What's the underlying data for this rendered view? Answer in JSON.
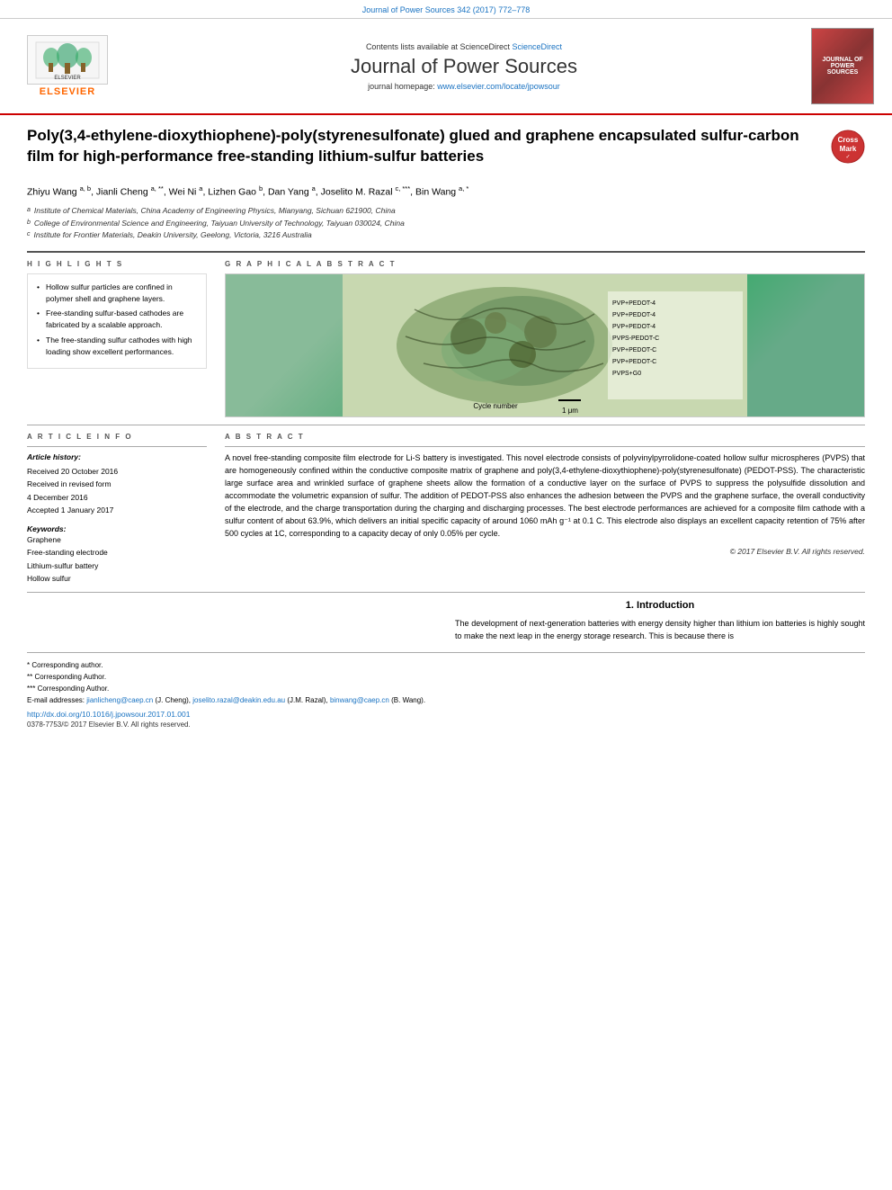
{
  "topbar": {
    "journal_ref": "Journal of Power Sources 342 (2017) 772–778"
  },
  "header": {
    "sciencedirect_text": "Contents lists available at ScienceDirect",
    "sciencedirect_link": "ScienceDirect",
    "journal_title": "Journal of Power Sources",
    "homepage_label": "journal homepage:",
    "homepage_url": "www.elsevier.com/locate/jpowsour",
    "elsevier_text": "ELSEVIER",
    "cover_text": "JOURNAL OF POWER SOURCES"
  },
  "article": {
    "title": "Poly(3,4-ethylene-dioxythiophene)-poly(styrenesulfonate) glued and graphene encapsulated sulfur-carbon film for high-performance free-standing lithium-sulfur batteries",
    "authors": "Zhiyu Wang a, b, Jianli Cheng a,**, Wei Ni a, Lizhen Gao b, Dan Yang a, Joselito M. Razal c,***, Bin Wang a,*",
    "affiliations": [
      "a Institute of Chemical Materials, China Academy of Engineering Physics, Mianyang, Sichuan 621900, China",
      "b College of Environmental Science and Engineering, Taiyuan University of Technology, Taiyuan 030024, China",
      "c Institute for Frontier Materials, Deakin University, Geelong, Victoria, 3216 Australia"
    ]
  },
  "highlights": {
    "heading": "H I G H L I G H T S",
    "items": [
      "Hollow sulfur particles are confined in polymer shell and graphene layers.",
      "Free-standing sulfur-based cathodes are fabricated by a scalable approach.",
      "The free-standing sulfur cathodes with high loading show excellent performances."
    ]
  },
  "graphical_abstract": {
    "heading": "G R A P H I C A L   A B S T R A C T",
    "cycle_label": "Cycle number",
    "scale_bar": "1 μm"
  },
  "article_info": {
    "heading": "A R T I C L E   I N F O",
    "history_label": "Article history:",
    "received": "Received 20 October 2016",
    "revised": "Received in revised form 4 December 2016",
    "accepted": "Accepted 1 January 2017",
    "keywords_label": "Keywords:",
    "keywords": [
      "Graphene",
      "Free-standing electrode",
      "Lithium-sulfur battery",
      "Hollow sulfur"
    ]
  },
  "abstract": {
    "heading": "A B S T R A C T",
    "text": "A novel free-standing composite film electrode for Li-S battery is investigated. This novel electrode consists of polyvinylpyrrolidone-coated hollow sulfur microspheres (PVPS) that are homogeneously confined within the conductive composite matrix of graphene and poly(3,4-ethylene-dioxythiophene)-poly(styrenesulfonate) (PEDOT-PSS). The characteristic large surface area and wrinkled surface of graphene sheets allow the formation of a conductive layer on the surface of PVPS to suppress the polysulfide dissolution and accommodate the volumetric expansion of sulfur. The addition of PEDOT-PSS also enhances the adhesion between the PVPS and the graphene surface, the overall conductivity of the electrode, and the charge transportation during the charging and discharging processes. The best electrode performances are achieved for a composite film cathode with a sulfur content of about 63.9%, which delivers an initial specific capacity of around 1060 mAh g⁻¹ at 0.1 C. This electrode also displays an excellent capacity retention of 75% after 500 cycles at 1C, corresponding to a capacity decay of only 0.05% per cycle.",
    "copyright": "© 2017 Elsevier B.V. All rights reserved."
  },
  "introduction": {
    "section_number": "1.",
    "section_title": "Introduction",
    "text": "The development of next-generation batteries with energy density higher than lithium ion batteries is highly sought to make the next leap in the energy storage research. This is because there is"
  },
  "footnotes": {
    "corresponding_1": "* Corresponding author.",
    "corresponding_2": "** Corresponding Author.",
    "corresponding_3": "*** Corresponding Author.",
    "email_label": "E-mail addresses:",
    "email_1": "jianlicheng@caep.cn",
    "email_1_name": "(J. Cheng),",
    "email_2": "joselito.razal@deakin.edu.au",
    "email_2_name": "(J.M. Razal),",
    "email_3": "binwang@caep.cn",
    "email_3_name": "(B. Wang).",
    "doi": "http://dx.doi.org/10.1016/j.jpowsour.2017.01.001",
    "issn": "0378-7753/© 2017 Elsevier B.V. All rights reserved."
  }
}
